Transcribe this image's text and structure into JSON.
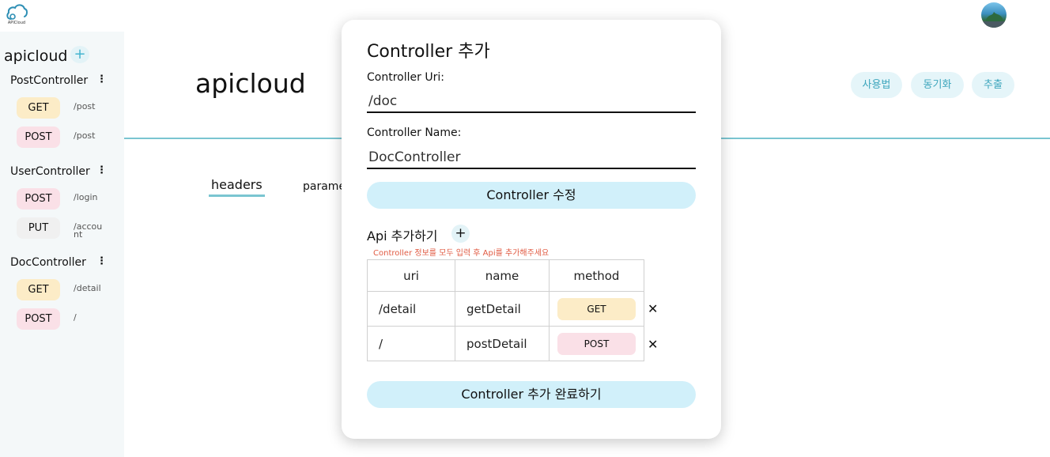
{
  "app": {
    "logo_text": "APICloud"
  },
  "sidebar": {
    "project": "apicloud",
    "add_icon": "+",
    "menu_icon": "⋮",
    "controllers": [
      {
        "name": "PostController",
        "apis": [
          {
            "method": "GET",
            "path": "/post"
          },
          {
            "method": "POST",
            "path": "/post"
          }
        ]
      },
      {
        "name": "UserController",
        "apis": [
          {
            "method": "POST",
            "path": "/login"
          },
          {
            "method": "PUT",
            "path": "/account"
          }
        ]
      },
      {
        "name": "DocController",
        "apis": [
          {
            "method": "GET",
            "path": "/detail"
          },
          {
            "method": "POST",
            "path": "/"
          }
        ]
      }
    ]
  },
  "main": {
    "title": "apicloud",
    "tabs": {
      "headers": "headers",
      "params": "parame"
    },
    "header_buttons": {
      "usage": "사용법",
      "sync": "동기화",
      "export": "추출"
    }
  },
  "modal": {
    "title": "Controller 추가",
    "uri_label": "Controller Uri:",
    "uri_value": "/doc",
    "name_label": "Controller Name:",
    "name_value": "DocController",
    "edit_button": "Controller 수정",
    "api_section_title": "Api 추가하기",
    "api_add_icon": "+",
    "api_warning": "Controller 정보를 모두 입력 후 Api를 추가해주세요",
    "table_headers": {
      "uri": "uri",
      "name": "name",
      "method": "method"
    },
    "rows": [
      {
        "uri": "/detail",
        "name": "getDetail",
        "method": "GET"
      },
      {
        "uri": "/",
        "name": "postDetail",
        "method": "POST"
      }
    ],
    "delete_icon": "✕",
    "complete_button": "Controller 추가 완료하기"
  },
  "colors": {
    "accent": "#7ac5d1",
    "button_bg": "#d1f0fa",
    "get": "#fcecc7",
    "post": "#fae0e7",
    "put": "#f0f0f0",
    "warning": "#e15b43"
  }
}
